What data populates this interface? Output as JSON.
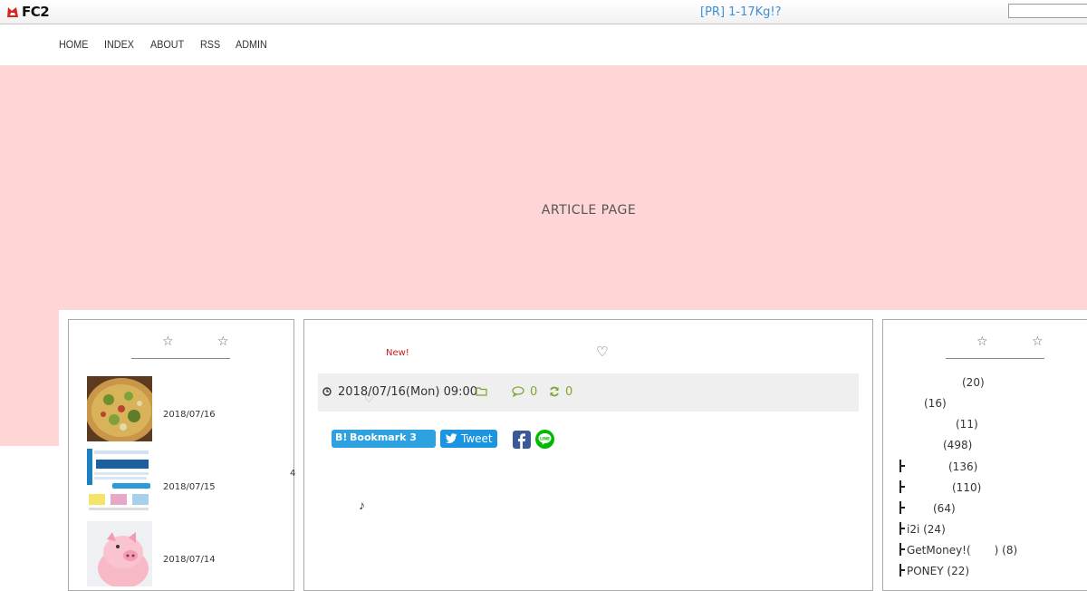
{
  "topbar": {
    "logo_text": "FC2",
    "pr_link": "[PR] 1-17Kg!?",
    "search_placeholder": ""
  },
  "nav": {
    "items": [
      {
        "label": "HOME"
      },
      {
        "label": "INDEX"
      },
      {
        "label": "ABOUT"
      },
      {
        "label": "RSS"
      },
      {
        "label": "ADMIN"
      }
    ]
  },
  "header": {
    "title": "ARTICLE PAGE",
    "background_color": "#ffd6d6"
  },
  "left_sidebar": {
    "heading_left_star": "☆",
    "heading_right_star": "☆",
    "entries": [
      {
        "date": "2018/07/16",
        "thumb": "pizza"
      },
      {
        "date": "2018/07/15",
        "thumb": "shopping-banner"
      },
      {
        "date": "2018/07/14",
        "thumb": "pink-pig"
      }
    ],
    "stray_number": "4"
  },
  "article": {
    "new_label": "New!",
    "title_heart": "♡",
    "date": "2018/07/16(Mon) 09:00",
    "meta_heart": "♡",
    "comment_count": "0",
    "trackback_count": "0",
    "accent_color": "#7ea62a",
    "hatena_label": "Bookmark 3",
    "hatena_mark": "B!",
    "tweet_label": "Tweet",
    "note_symbol": "♪"
  },
  "right_sidebar": {
    "heading_left_star": "☆",
    "heading_right_star": "☆",
    "categories": [
      {
        "label": "(20)"
      },
      {
        "label": "(16)"
      },
      {
        "label": "(11)"
      },
      {
        "label": "(498)"
      },
      {
        "label": "(136)"
      },
      {
        "label": "(110)"
      },
      {
        "label": "(64)"
      },
      {
        "label": "i2i (24)"
      },
      {
        "label": "GetMoney!(",
        "suffix": ") (8)"
      },
      {
        "label": "PONEY (22)"
      }
    ]
  }
}
